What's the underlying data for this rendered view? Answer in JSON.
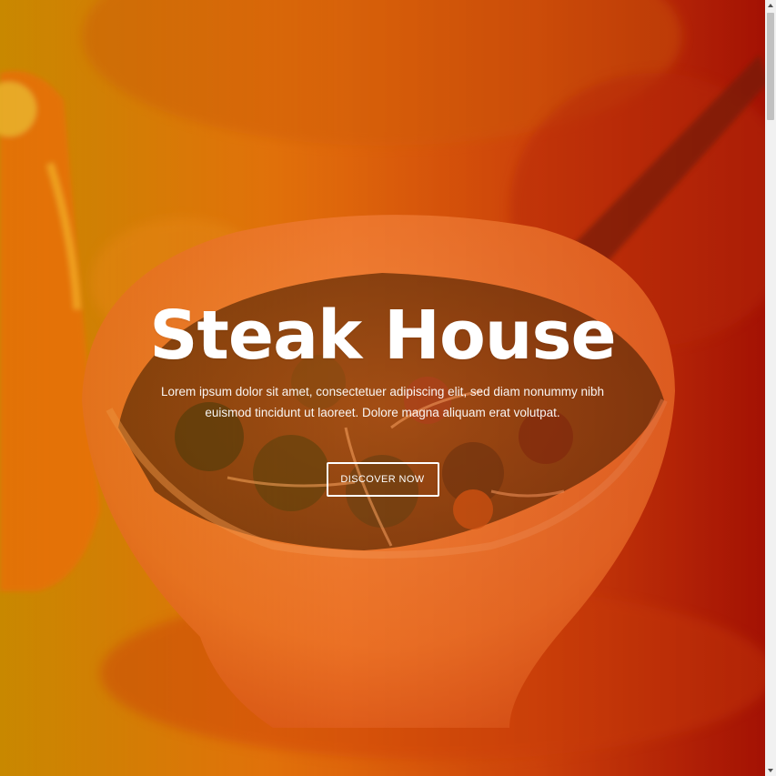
{
  "hero": {
    "title": "Steak House",
    "text": "Lorem ipsum dolor sit amet, consectetuer adipiscing elit, sed diam nonummy nibh euismod tincidunt ut laoreet. Dolore magna aliquam erat volutpat.",
    "button_label": "DISCOVER NOW",
    "photo": "food-bowl-photo"
  },
  "scrollbar": {
    "up_icon": "arrow-up-icon",
    "down_icon": "arrow-down-icon"
  },
  "colors": {
    "overlay_left": "#e0b000",
    "overlay_right": "#b81a00",
    "text": "#ffffff"
  }
}
